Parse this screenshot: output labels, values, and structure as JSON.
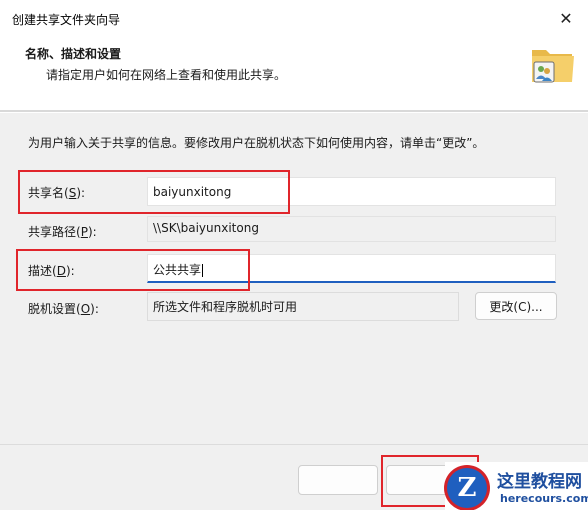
{
  "window": {
    "title": "创建共享文件夹向导",
    "close_glyph": "✕"
  },
  "header": {
    "title": "名称、描述和设置",
    "subtitle": "请指定用户如何在网络上查看和使用此共享。",
    "icon": "shared-folder-icon"
  },
  "intro": "为用户输入关于共享的信息。要修改用户在脱机状态下如何使用内容，请单击“更改”。",
  "fields": {
    "share_name": {
      "label": "共享名",
      "accel": "S",
      "value": "baiyunxitong"
    },
    "share_path": {
      "label": "共享路径",
      "accel": "P",
      "value": "\\\\SK\\baiyunxitong"
    },
    "description": {
      "label": "描述",
      "accel": "D",
      "value": "公共共享"
    },
    "offline": {
      "label": "脱机设置",
      "accel": "O",
      "value": "所选文件和程序脱机时可用",
      "change_label": "更改(C)..."
    }
  },
  "watermark": {
    "title": "这里教程网",
    "url": "herecours.com",
    "badge": "Z"
  },
  "colors": {
    "highlight": "#e0252b",
    "focus": "#1f5fbf",
    "body_bg": "#f0f0f0"
  }
}
